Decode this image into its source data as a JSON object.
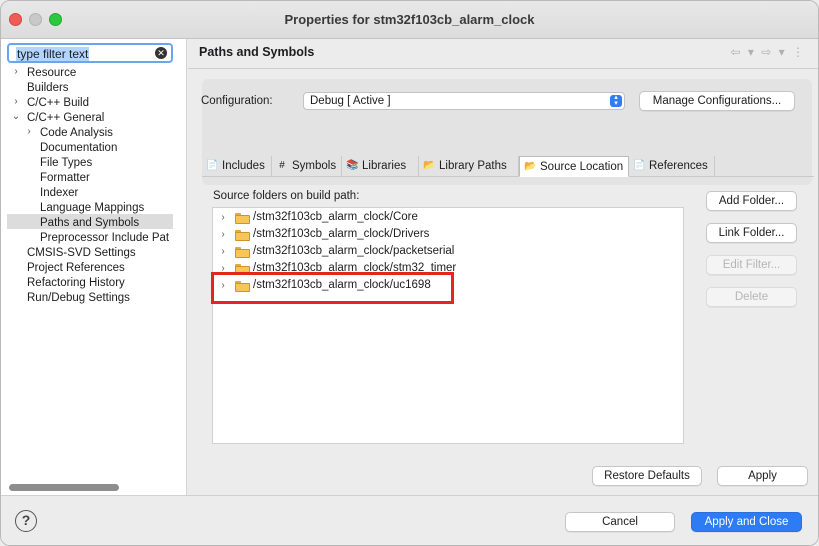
{
  "window": {
    "title": "Properties for stm32f103cb_alarm_clock"
  },
  "filter": {
    "value": "type filter text"
  },
  "tree": [
    {
      "label": "Resource",
      "chevron": "›",
      "level": 0
    },
    {
      "label": "Builders",
      "chevron": "",
      "level": 0
    },
    {
      "label": "C/C++ Build",
      "chevron": "›",
      "level": 0
    },
    {
      "label": "C/C++ General",
      "chevron": "⌄",
      "level": 0
    },
    {
      "label": "Code Analysis",
      "chevron": "›",
      "level": 1
    },
    {
      "label": "Documentation",
      "chevron": "",
      "level": 1
    },
    {
      "label": "File Types",
      "chevron": "",
      "level": 1
    },
    {
      "label": "Formatter",
      "chevron": "",
      "level": 1
    },
    {
      "label": "Indexer",
      "chevron": "",
      "level": 1
    },
    {
      "label": "Language Mappings",
      "chevron": "",
      "level": 1
    },
    {
      "label": "Paths and Symbols",
      "chevron": "",
      "level": 1,
      "selected": true
    },
    {
      "label": "Preprocessor Include Pat",
      "chevron": "",
      "level": 1
    },
    {
      "label": "CMSIS-SVD Settings",
      "chevron": "",
      "level": 0
    },
    {
      "label": "Project References",
      "chevron": "",
      "level": 0
    },
    {
      "label": "Refactoring History",
      "chevron": "",
      "level": 0
    },
    {
      "label": "Run/Debug Settings",
      "chevron": "",
      "level": 0
    }
  ],
  "page": {
    "title": "Paths and Symbols",
    "nav_arrows": "⇦ ▾ ⇨ ▾ ⋮"
  },
  "configuration": {
    "label": "Configuration:",
    "value": "Debug  [ Active ]",
    "manage_label": "Manage Configurations..."
  },
  "tabs": [
    {
      "label": "Includes",
      "icon": "includes-icon",
      "glyph": "📄",
      "active": false
    },
    {
      "label": "Symbols",
      "icon": "hash-icon",
      "glyph": "#",
      "active": false
    },
    {
      "label": "Libraries",
      "icon": "libraries-icon",
      "glyph": "📚",
      "active": false
    },
    {
      "label": "Library Paths",
      "icon": "library-paths-icon",
      "glyph": "📂",
      "active": false
    },
    {
      "label": "Source Location",
      "icon": "source-location-icon",
      "glyph": "📂",
      "active": true
    },
    {
      "label": "References",
      "icon": "references-icon",
      "glyph": "📄",
      "active": false
    }
  ],
  "source": {
    "label": "Source folders on build path:",
    "folders": [
      "/stm32f103cb_alarm_clock/Core",
      "/stm32f103cb_alarm_clock/Drivers",
      "/stm32f103cb_alarm_clock/packetserial",
      "/stm32f103cb_alarm_clock/stm32_timer",
      "/stm32f103cb_alarm_clock/uc1698"
    ],
    "buttons": {
      "add": "Add Folder...",
      "link": "Link Folder...",
      "edit": "Edit Filter...",
      "delete": "Delete"
    }
  },
  "footer": {
    "restore": "Restore Defaults",
    "apply": "Apply",
    "cancel": "Cancel",
    "apply_close": "Apply and Close",
    "help": "?"
  },
  "colors": {
    "accent": "#2d7cf6",
    "highlight_box": "#e3271f",
    "folder": "#f6c65a"
  }
}
